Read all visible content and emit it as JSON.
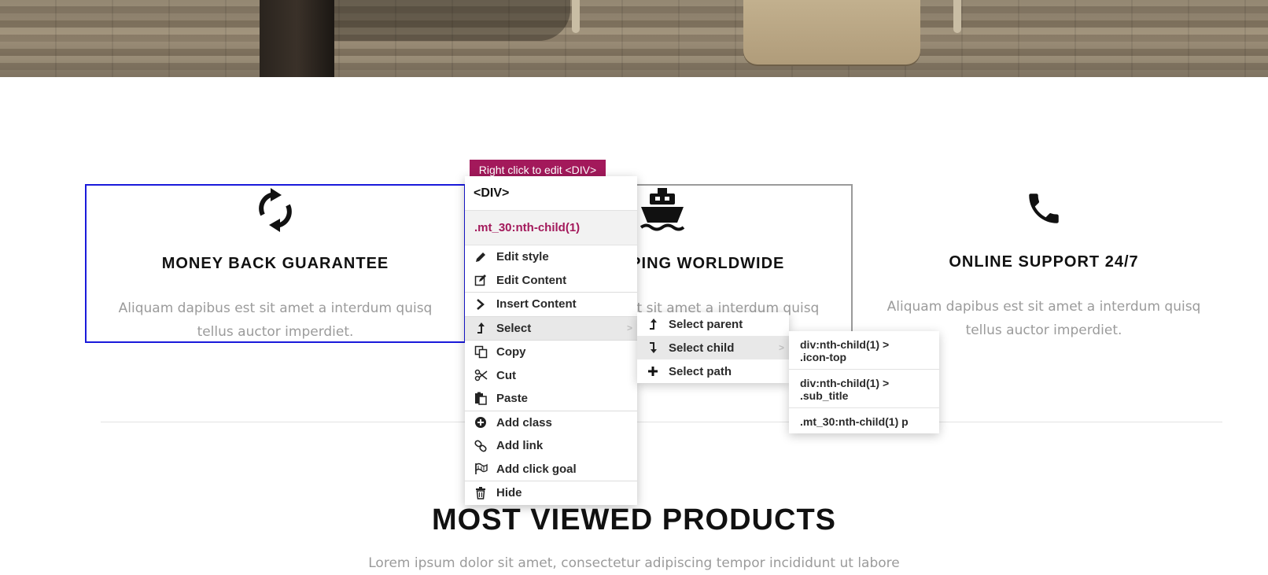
{
  "tooltip": {
    "text": "Right click to edit <DIV>"
  },
  "features": [
    {
      "title": "MONEY BACK GUARANTEE",
      "description": "Aliquam dapibus est sit amet a interdum quisq tellus auctor imperdiet.",
      "icon": "refresh-icon"
    },
    {
      "title": "FREE SHIPPING WORLDWIDE",
      "description": "Aliquam dapibus est sit amet a interdum quisq tellus auctor imperdiet.",
      "icon": "ship-icon"
    },
    {
      "title": "ONLINE SUPPORT 24/7",
      "description": "Aliquam dapibus est sit amet a interdum quisq tellus auctor imperdiet.",
      "icon": "phone-icon"
    }
  ],
  "section": {
    "title": "MOST VIEWED PRODUCTS",
    "subtitle": "Lorem ipsum dolor sit amet, consectetur adipiscing tempor incididunt ut labore"
  },
  "context_menu": {
    "header": "<DIV>",
    "selector": ".mt_30:nth-child(1)",
    "items": {
      "edit_style": "Edit style",
      "edit_content": "Edit Content",
      "insert_content": "Insert Content",
      "select": "Select",
      "copy": "Copy",
      "cut": "Cut",
      "paste": "Paste",
      "add_class": "Add class",
      "add_link": "Add link",
      "add_click_goal": "Add click goal",
      "hide": "Hide"
    },
    "submenu_arrow": ">"
  },
  "select_submenu": {
    "select_parent": "Select parent",
    "select_child": "Select child",
    "select_path": "Select path"
  },
  "child_submenu": {
    "items": [
      "div:nth-child(1) >\n.icon-top",
      "div:nth-child(1) >\n.sub_title",
      ".mt_30:nth-child(1) p"
    ]
  },
  "colors": {
    "accent": "#a3195b",
    "selection_border": "#1a1adb",
    "muted_text": "#9b9b9b"
  }
}
